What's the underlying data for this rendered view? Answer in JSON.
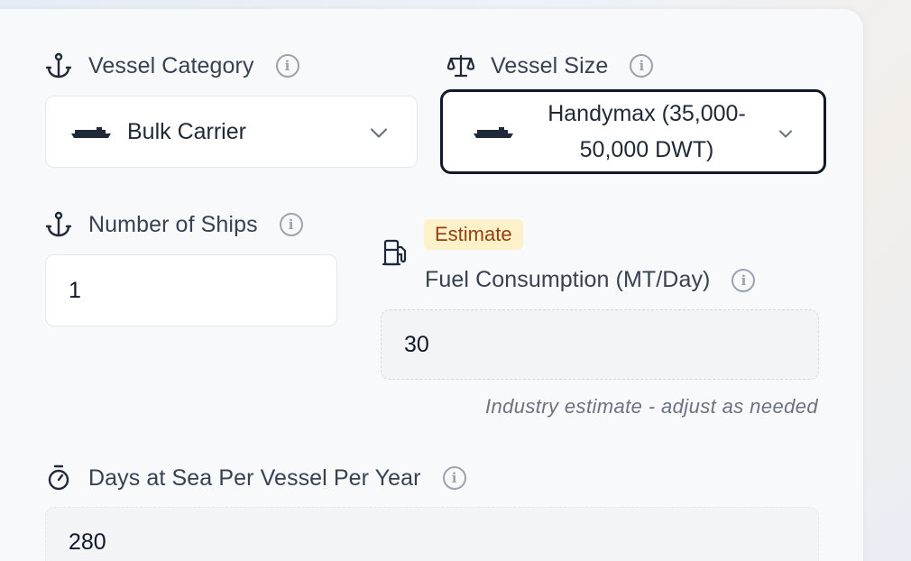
{
  "vessel_category": {
    "label": "Vessel Category",
    "value": "Bulk Carrier"
  },
  "vessel_size": {
    "label": "Vessel Size",
    "value_line1": "Handymax (35,000-",
    "value_line2": "50,000 DWT)"
  },
  "number_of_ships": {
    "label": "Number of Ships",
    "value": "1"
  },
  "fuel_consumption": {
    "badge": "Estimate",
    "label": "Fuel Consumption (MT/Day)",
    "value": "30",
    "hint": "Industry estimate - adjust as needed"
  },
  "days_at_sea": {
    "label": "Days at Sea Per Vessel Per Year",
    "value": "280"
  },
  "info_glyph": "i"
}
